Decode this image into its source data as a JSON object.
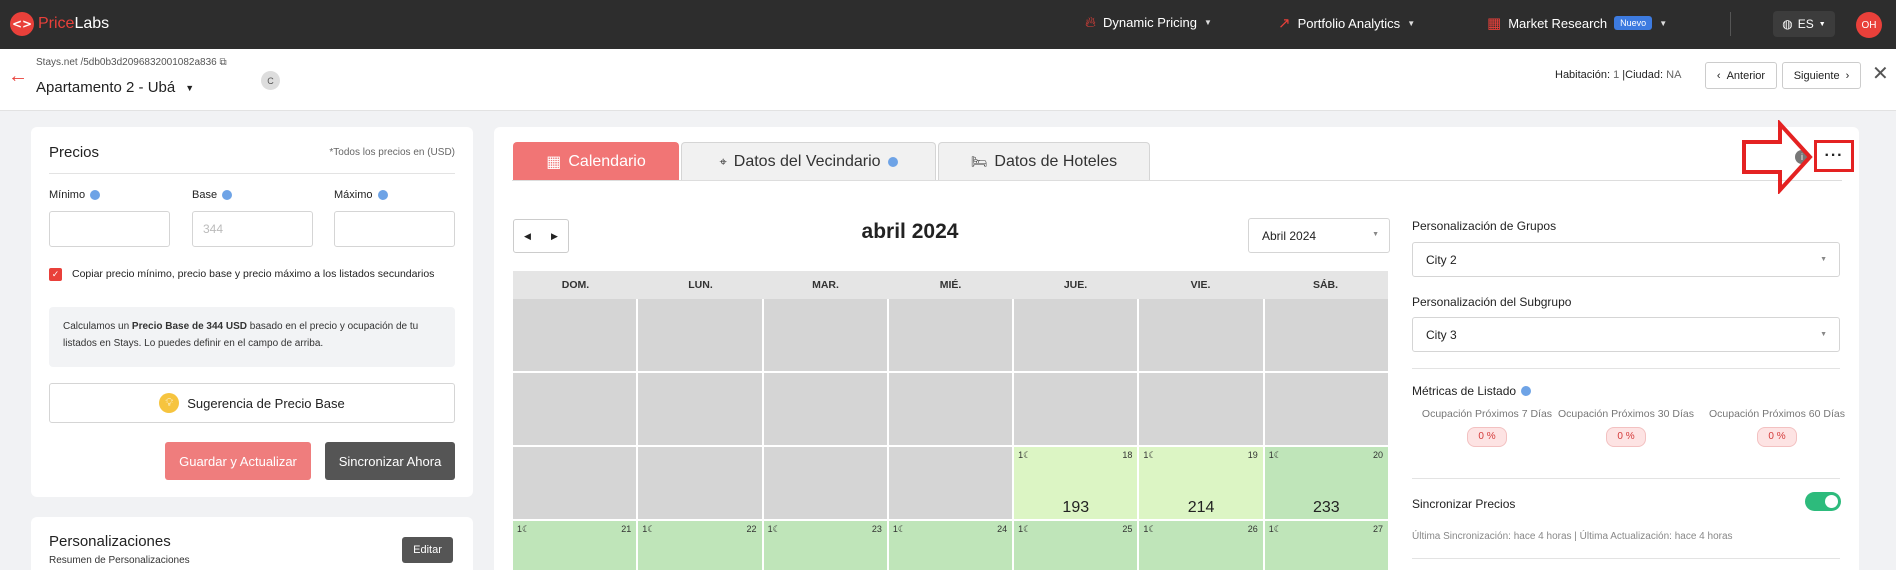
{
  "navbar": {
    "brand_price": "Price",
    "brand_labs": "Labs",
    "dynamic_pricing": "Dynamic Pricing",
    "portfolio_analytics": "Portfolio Analytics",
    "market_research": "Market Research",
    "badge_new": "Nuevo",
    "language": "ES",
    "user_initials": "OH"
  },
  "subheader": {
    "breadcrumb": "Stays.net /5db0b3d2096832001082a836",
    "listing_name": "Apartamento 2 - Ubá",
    "channel_badge": "C",
    "room_label": "Habitación:",
    "room_value": "1",
    "city_label": "|Ciudad:",
    "city_value": "NA",
    "prev_label": "Anterior",
    "next_label": "Siguiente"
  },
  "prices_card": {
    "title": "Precios",
    "note": "*Todos los precios en (USD)",
    "min_label": "Mínimo",
    "base_label": "Base",
    "max_label": "Máximo",
    "min_value": "",
    "base_placeholder": "344",
    "max_value": "",
    "copy_label": "Copiar precio mínimo, precio base y precio máximo a los listados secundarios",
    "info_pre": "Calculamos un ",
    "info_bold": "Precio Base de 344 USD",
    "info_post": " basado en el precio y ocupación de tu listados en Stays. Lo puedes definir en el campo de arriba.",
    "suggest_label": "Sugerencia de Precio Base",
    "save_label": "Guardar y Actualizar",
    "sync_label": "Sincronizar Ahora"
  },
  "customizations_card": {
    "title": "Personalizaciones",
    "subtitle": "Resumen de Personalizaciones",
    "edit_label": "Editar"
  },
  "tabs": [
    {
      "label": "Calendario",
      "icon": "calendar-icon"
    },
    {
      "label": "Datos del Vecindario",
      "icon": "location-pin-icon"
    },
    {
      "label": "Datos de Hoteles",
      "icon": "bed-icon"
    }
  ],
  "calendar": {
    "month_title": "abril 2024",
    "month_select": "Abril 2024",
    "weekdays": [
      "DOM.",
      "LUN.",
      "MAR.",
      "MIÉ.",
      "JUE.",
      "VIE.",
      "SÁB."
    ],
    "rows": [
      [
        {},
        {},
        {},
        {},
        {},
        {},
        {}
      ],
      [
        {},
        {},
        {},
        {},
        {},
        {},
        {}
      ],
      [
        {},
        {},
        {},
        {},
        {
          "day": "18",
          "moon": "1☾",
          "price": "193",
          "tone": "light"
        },
        {
          "day": "19",
          "moon": "1☾",
          "price": "214",
          "tone": "light"
        },
        {
          "day": "20",
          "moon": "1☾",
          "price": "233",
          "tone": "green"
        }
      ],
      [
        {
          "day": "21",
          "moon": "1☾",
          "price": "",
          "tone": "green"
        },
        {
          "day": "22",
          "moon": "1☾",
          "price": "",
          "tone": "green"
        },
        {
          "day": "23",
          "moon": "1☾",
          "price": "",
          "tone": "green"
        },
        {
          "day": "24",
          "moon": "1☾",
          "price": "",
          "tone": "green"
        },
        {
          "day": "25",
          "moon": "1☾",
          "price": "",
          "tone": "green"
        },
        {
          "day": "26",
          "moon": "1☾",
          "price": "",
          "tone": "green"
        },
        {
          "day": "27",
          "moon": "1☾",
          "price": "",
          "tone": "green"
        }
      ]
    ]
  },
  "right_panel": {
    "group_label": "Personalización de Grupos",
    "group_value": "City 2",
    "subgroup_label": "Personalización del Subgrupo",
    "subgroup_value": "City 3",
    "metrics_label": "Métricas de Listado",
    "metrics": [
      {
        "label": "Ocupación Próximos 7 Días",
        "value": "0 %"
      },
      {
        "label": "Ocupación Próximos 30 Días",
        "value": "0 %"
      },
      {
        "label": "Ocupación Próximos 60 Días",
        "value": "0 %"
      }
    ],
    "sync_label": "Sincronizar Precios",
    "sync_enabled": true,
    "sync_status": "Última Sincronización: hace 4 horas | Última Actualización: hace 4 horas"
  },
  "colors": {
    "brand": "#e9403a",
    "tab_active": "#f17575",
    "annotation": "#e42222",
    "toggle_on": "#2dbb7c"
  }
}
